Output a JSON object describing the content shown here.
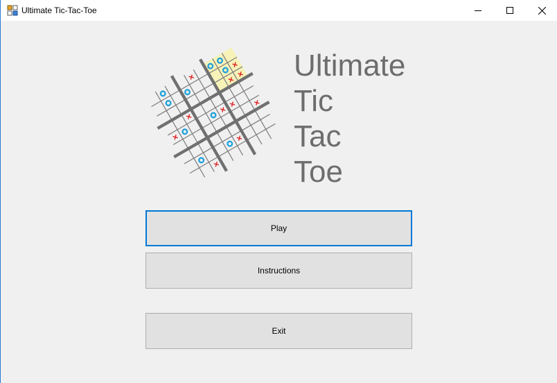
{
  "window": {
    "title": "Ultimate Tic-Tac-Toe",
    "controls": {
      "minimize": "minimize-icon",
      "maximize": "maximize-icon",
      "close": "close-icon"
    }
  },
  "hero": {
    "title_lines": [
      "Ultimate",
      "Tic",
      "Tac",
      "Toe"
    ],
    "logo": "ultimate-tic-tac-toe-board-logo"
  },
  "menu": {
    "play_label": "Play",
    "instructions_label": "Instructions",
    "exit_label": "Exit"
  },
  "colors": {
    "title_text": "#6d6d6d",
    "button_face": "#e1e1e1",
    "focus_border": "#0078d7",
    "o_mark": "#1ea0dc",
    "x_mark": "#e02020",
    "highlight_cell": "#f7f2b8"
  }
}
